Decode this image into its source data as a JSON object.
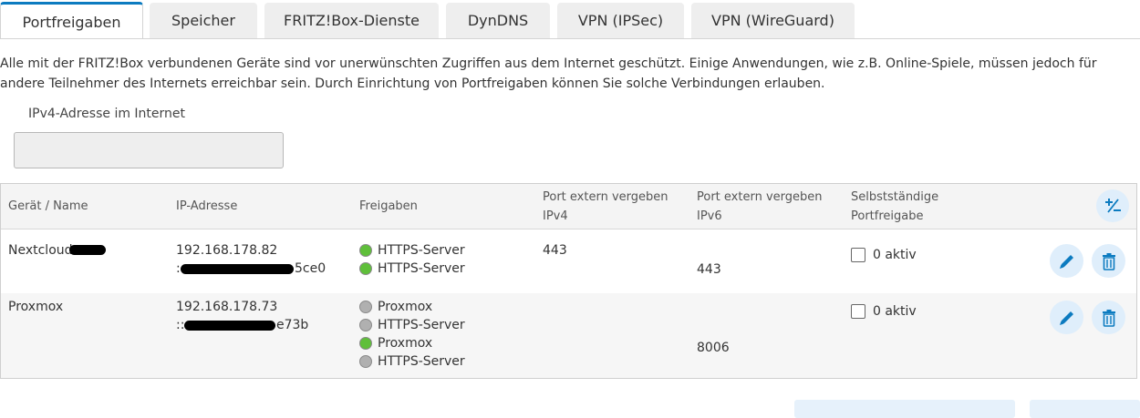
{
  "tabs": [
    {
      "label": "Portfreigaben",
      "active": true
    },
    {
      "label": "Speicher"
    },
    {
      "label": "FRITZ!Box-Dienste"
    },
    {
      "label": "DynDNS"
    },
    {
      "label": "VPN (IPSec)"
    },
    {
      "label": "VPN (WireGuard)"
    }
  ],
  "intro": "Alle mit der FRITZ!Box verbundenen Geräte sind vor unerwünschten Zugriffen aus dem Internet geschützt. Einige Anwendungen, wie z.B. Online-Spiele, müssen jedoch für andere Teilnehmer des Internets erreichbar sein. Durch Einrichtung von Portfreigaben können Sie solche Verbindungen erlauben.",
  "ipv4": {
    "label": "IPv4-Adresse im Internet",
    "value": ""
  },
  "table": {
    "headers": {
      "device": "Gerät / Name",
      "ip": "IP-Adresse",
      "shares": "Freigaben",
      "port_ipv4_l1": "Port extern vergeben",
      "port_ipv4_l2": "IPv4",
      "port_ipv6_l1": "Port extern vergeben",
      "port_ipv6_l2": "IPv6",
      "self_l1": "Selbstständige",
      "self_l2": "Portfreigabe"
    },
    "rows": [
      {
        "name": "Nextcloud",
        "ipv4": "192.168.178.82",
        "ipv6_start": ":",
        "ipv6_end": "5ce0",
        "shares": [
          {
            "label": "HTTPS-Server",
            "status": "green"
          },
          {
            "label": "HTTPS-Server",
            "status": "green"
          }
        ],
        "port_ipv4": "443",
        "port_ipv6": "443",
        "self_label": "0 aktiv"
      },
      {
        "name": "Proxmox",
        "ipv4": "192.168.178.73",
        "ipv6_start": "::",
        "ipv6_end": "e73b",
        "shares": [
          {
            "label": "Proxmox",
            "status": "grey"
          },
          {
            "label": "HTTPS-Server",
            "status": "grey"
          },
          {
            "label": "Proxmox",
            "status": "green"
          },
          {
            "label": "HTTPS-Server",
            "status": "grey"
          }
        ],
        "port_ipv4": "",
        "port_ipv6": "8006",
        "self_label": "0 aktiv"
      }
    ]
  },
  "colors": {
    "accent": "#0c7bc0",
    "status_green": "#5fbf3a",
    "status_grey": "#b0b0b0",
    "button_bg": "#dfeefb"
  },
  "icons": {
    "edit": "pencil-icon",
    "delete": "trash-icon",
    "sort": "plus-minus-icon"
  }
}
